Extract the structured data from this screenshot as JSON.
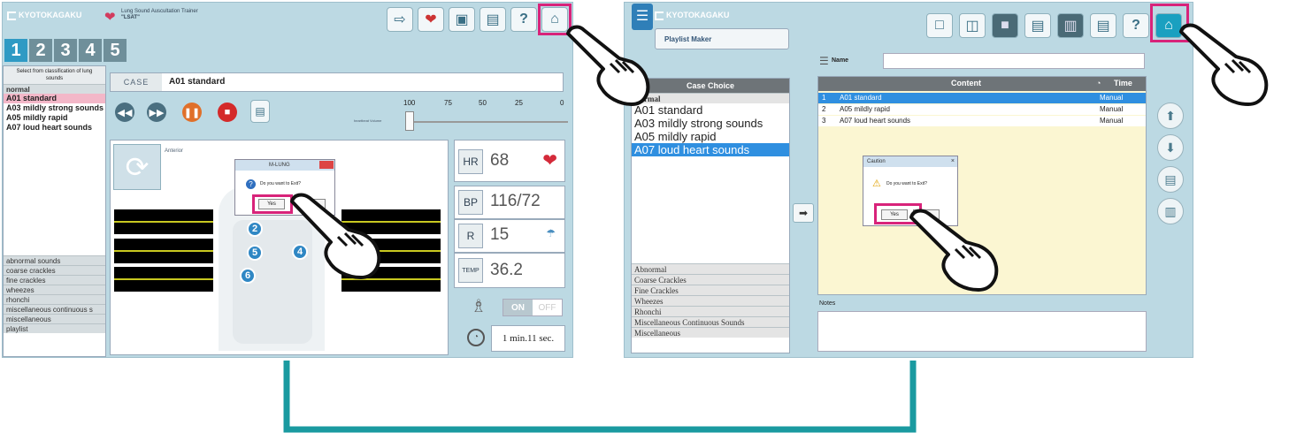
{
  "left_app": {
    "brand": "KYOTOKAGAKU",
    "app_title_line1": "Lung Sound Auscultation Trainer",
    "app_title_line2": "\"LSAT\"",
    "number_tabs": [
      "1",
      "2",
      "3",
      "4",
      "5"
    ],
    "list_header": "Select from classification of lung sounds",
    "normal_category": "normal",
    "case_items": [
      "A01 standard",
      "A03 mildly strong sounds",
      "A05 mildly rapid",
      "A07 loud heart sounds"
    ],
    "categories": [
      "abnormal sounds",
      "coarse crackles",
      "fine crackles",
      "wheezes",
      "rhonchi",
      "miscellaneous continuous s",
      "miscellaneous",
      "playlist"
    ],
    "case_label": "CASE",
    "case_value": "A01 standard",
    "volume_ticks": [
      "100",
      "75",
      "50",
      "25",
      "0"
    ],
    "volume_label": "heartbeat Volume",
    "chest_label": "Anterior",
    "bubbles": [
      "2",
      "5",
      "6",
      "4"
    ],
    "vitals": {
      "hr_label": "HR",
      "hr_value": "68",
      "bp_label": "BP",
      "bp_value": "116/72",
      "r_label": "R",
      "r_value": "15",
      "temp_label": "TEMP",
      "temp_value": "36.2"
    },
    "toggle_on": "ON",
    "toggle_off": "OFF",
    "timer": "1 min.11 sec.",
    "dialog_title": "M-LUNG",
    "dialog_text": "Do you want to Exit?",
    "dialog_yes": "Yes",
    "dialog_no": "No",
    "help_glyph": "?"
  },
  "right_app": {
    "brand": "KYOTOKAGAKU",
    "playlist_maker": "Playlist Maker",
    "name_label": "Name",
    "case_choice_header": "Case Choice",
    "normal_category": "Normal",
    "case_items": [
      "A01 standard",
      "A03 mildly strong sounds",
      "A05 mildly rapid",
      "A07 loud heart sounds"
    ],
    "categories": [
      "Abnormal",
      "Coarse Crackles",
      "Fine Crackles",
      "Wheezes",
      "Rhonchi",
      "Miscellaneous Continuous Sounds",
      "Miscellaneous"
    ],
    "content_header": "Content",
    "time_header": "Time",
    "playlist_rows": [
      {
        "num": "1",
        "content": "A01 standard",
        "time": "Manual"
      },
      {
        "num": "2",
        "content": "A05 mildly rapid",
        "time": "Manual"
      },
      {
        "num": "3",
        "content": "A07 loud heart sounds",
        "time": "Manual"
      }
    ],
    "notes_label": "Notes",
    "dialog_title": "Caution",
    "dialog_text": "Do you want to Exit?",
    "dialog_yes": "Yes",
    "dialog_no": "No",
    "help_glyph": "?"
  },
  "colors": {
    "panel_bg": "#bcd9e3",
    "highlight": "#d8237a",
    "connector": "#1a9aa0",
    "selection": "#2f8fe0"
  }
}
